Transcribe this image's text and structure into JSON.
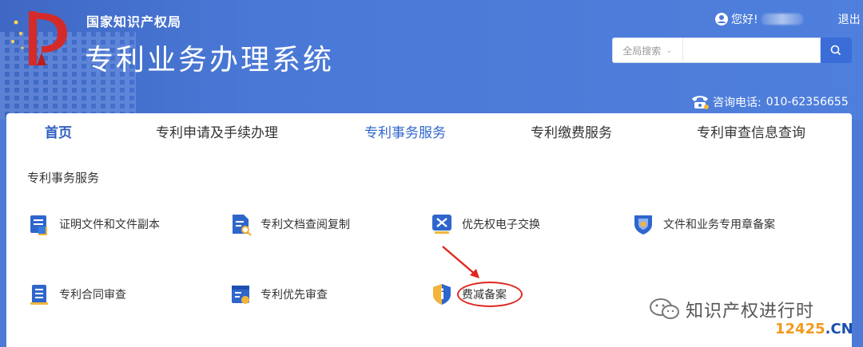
{
  "header": {
    "org_name": "国家知识产权局",
    "system_title": "专利业务办理系统",
    "greeting": "您好!",
    "logout": "退出",
    "search": {
      "scope": "全局搜索",
      "placeholder": "",
      "button_icon": "search-icon"
    },
    "phone_label": "咨询电话:",
    "phone_number": "010-62356655"
  },
  "nav": {
    "items": [
      {
        "label": "首页"
      },
      {
        "label": "专利申请及手续办理"
      },
      {
        "label": "专利事务服务"
      },
      {
        "label": "专利缴费服务"
      },
      {
        "label": "专利审查信息查询"
      }
    ],
    "active": "专利事务服务"
  },
  "section": {
    "title": "专利事务服务"
  },
  "services": [
    {
      "label": "证明文件和文件副本",
      "icon": "document-copy-icon"
    },
    {
      "label": "专利文档查阅复制",
      "icon": "document-search-icon"
    },
    {
      "label": "优先权电子交换",
      "icon": "exchange-icon"
    },
    {
      "label": "文件和业务专用章备案",
      "icon": "seal-shield-icon"
    },
    {
      "label": "专利合同审查",
      "icon": "contract-icon"
    },
    {
      "label": "专利优先审查",
      "icon": "priority-review-icon"
    },
    {
      "label": "费减备案",
      "icon": "fee-reduction-shield-icon"
    }
  ],
  "watermark": {
    "text": "知识产权进行时",
    "brand_number": "12425",
    "brand_suffix": ".CN"
  },
  "colors": {
    "header_blue": "#4a78d6",
    "accent_blue": "#2f66cc",
    "annotation_red": "#e0271f"
  }
}
